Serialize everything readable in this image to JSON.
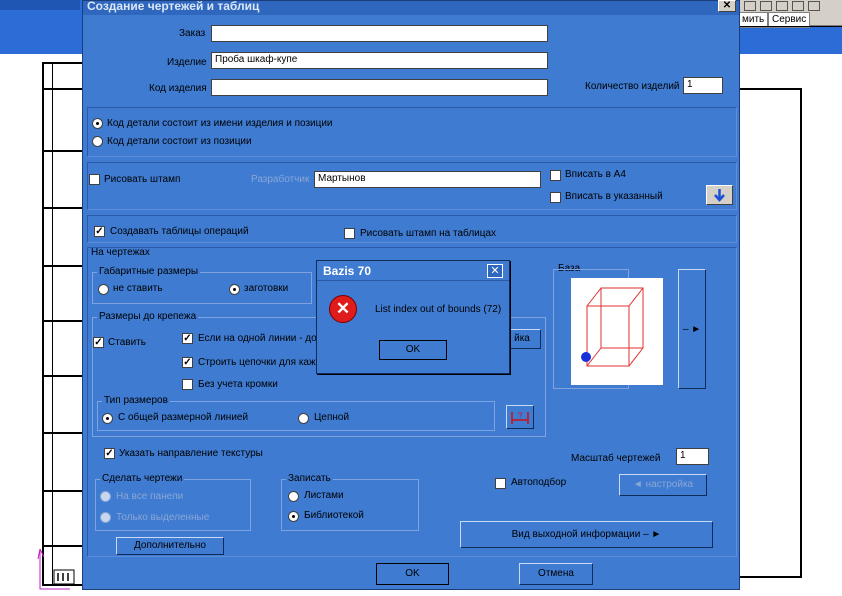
{
  "background": {
    "menu_items": [
      "мить",
      "Сервис"
    ]
  },
  "dialog": {
    "title": "Создание чертежей и таблиц",
    "close_glyph": "✕",
    "order_label": "Заказ",
    "order_value": "",
    "product_label": "Изделие",
    "product_value": "Проба шкаф-купе",
    "product_code_label": "Код изделия",
    "product_code_value": "",
    "quantity_label": "Количество изделий",
    "quantity_value": "1",
    "radio_code_1": "Код детали состоит из  имени изделия и позиции",
    "radio_code_2": "Код детали состоит из   позиции",
    "draw_stamp": "Рисовать штамп",
    "developer_label": "Разработчик",
    "developer_value": "Мартынов",
    "fit_a4": "Вписать в А4",
    "fit_specified": "Вписать в указанный",
    "create_tables": "Создавать таблицы операций",
    "draw_stamp_tables": "Рисовать штамп на таблицах",
    "on_drawings": "На чертежах",
    "overall_dims": "Габаритные размеры",
    "dont_set": "не ставить",
    "blanks": "заготовки",
    "dims_to_fastener": "Размеры до  крепежа",
    "set": "Ставить",
    "if_one_line": "Если на одной линии - до",
    "build_chains": "Строить цепочки для каж",
    "no_edge": "Без учета кромки",
    "dim_type": "Тип размеров",
    "common_dim_line": "С общей размерной линией",
    "chain": "Цепной",
    "side_btn_glyph": "–",
    "base_label": "База",
    "indicate_texture": "Указать направление текстуры",
    "scale_label": "Масштаб чертежей",
    "scale_value": "1",
    "make_drawings": "Сделать чертежи",
    "all_panels": "На все панели",
    "selected_only": "Только выделенные",
    "write": "Записать",
    "as_sheets": "Листами",
    "as_library": "Библиотекой",
    "auto_select": "Автоподбор",
    "settings_btn": "◄ настройка",
    "additional_btn": "Дополнительно",
    "output_info_btn": "Вид выходной  информации  – ►",
    "ok_btn": "OK",
    "cancel_btn": "Отмена",
    "partial_btn": "йка"
  },
  "modal": {
    "title": "Bazis 70",
    "message": "List index out of bounds (72)",
    "ok": "OK",
    "close_glyph": "✕"
  }
}
